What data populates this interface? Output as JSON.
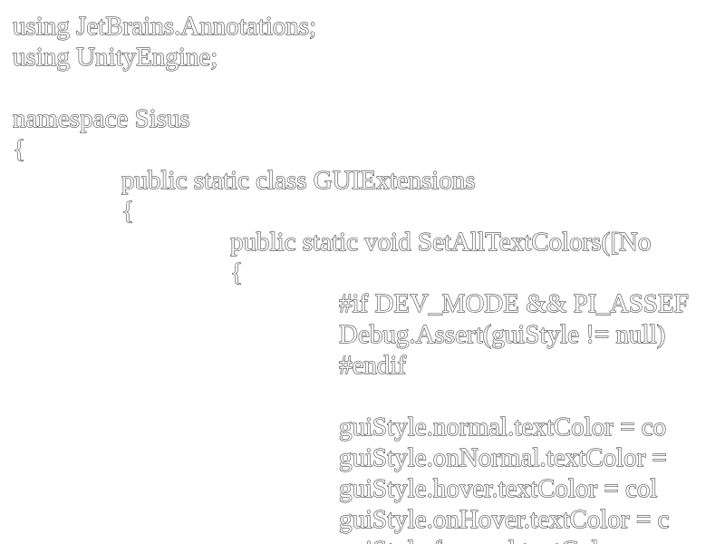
{
  "code": {
    "lines": [
      {
        "indent": 0,
        "text": "using JetBrains.Annotations;"
      },
      {
        "indent": 0,
        "text": "using UnityEngine;"
      },
      {
        "indent": 0,
        "text": ""
      },
      {
        "indent": 0,
        "text": "namespace Sisus"
      },
      {
        "indent": 0,
        "text": "{"
      },
      {
        "indent": 1,
        "text": "public static class GUIExtensions"
      },
      {
        "indent": 1,
        "text": "{"
      },
      {
        "indent": 2,
        "text": "public static void SetAllTextColors([No"
      },
      {
        "indent": 2,
        "text": "{"
      },
      {
        "indent": 3,
        "text": "#if DEV_MODE && PI_ASSEF"
      },
      {
        "indent": 3,
        "text": "Debug.Assert(guiStyle != null)"
      },
      {
        "indent": 3,
        "text": "#endif"
      },
      {
        "indent": 0,
        "text": ""
      },
      {
        "indent": 3,
        "text": "guiStyle.normal.textColor = co"
      },
      {
        "indent": 3,
        "text": "guiStyle.onNormal.textColor ="
      },
      {
        "indent": 3,
        "text": "guiStyle.hover.textColor = col"
      },
      {
        "indent": 3,
        "text": "guiStyle.onHover.textColor = c"
      },
      {
        "indent": 3,
        "text": "guiStyle.focused.textColor"
      }
    ]
  }
}
